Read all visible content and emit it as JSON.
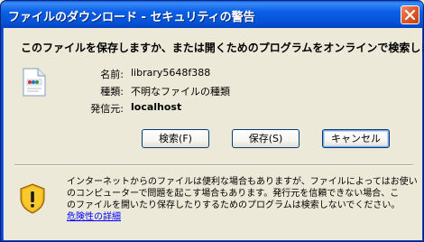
{
  "window": {
    "title": "ファイルのダウンロード - セキュリティの警告"
  },
  "dialog": {
    "question": "このファイルを保存しますか、または開くためのプログラムをオンラインで検索しますか?",
    "fields": [
      {
        "label": "名前:",
        "value": "library5648f388"
      },
      {
        "label": "種類:",
        "value": "不明なファイルの種類"
      },
      {
        "label": "発信元:",
        "value": "localhost"
      }
    ],
    "buttons": {
      "search": "検索(F)",
      "save": "保存(S)",
      "cancel": "キャンセル"
    },
    "warning": {
      "lines": [
        "インターネットからのファイルは便利な場合もありますが、ファイルによってはお使い",
        "のコンピューターで問題を起こす場合もあります。発行元を信頼できない場合、こ",
        "のファイルを開いたり保存したりするためのプログラムは検索しないでください。"
      ],
      "link": "危険性の詳細"
    }
  },
  "colors": {
    "titlebar": "#0552d6",
    "face": "#ece9d8",
    "link": "#0000ff"
  },
  "icons": {
    "file": "unknown-file-icon",
    "warning": "security-shield-icon",
    "close": "close-icon"
  }
}
